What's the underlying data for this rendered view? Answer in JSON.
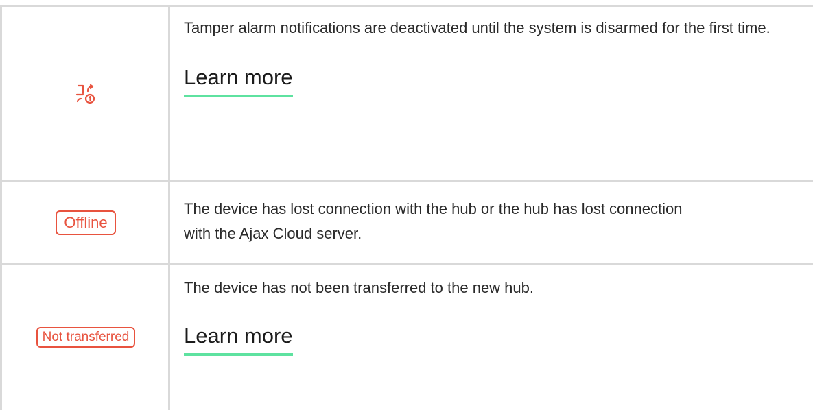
{
  "colors": {
    "status_red": "#e8533f",
    "link_underline": "#5ee2a0",
    "grid": "#d9d9d9"
  },
  "rows": [
    {
      "icon": "tamper-icon",
      "description": "Tamper alarm notifications are deactivated until the system is disarmed for the first time.",
      "link_label": "Learn more"
    },
    {
      "badge": "Offline",
      "description": "The device has lost connection with the hub or the hub has lost connection with the Ajax Cloud server."
    },
    {
      "badge": "Not transferred",
      "description": "The device has not been transferred to the new hub.",
      "link_label": "Learn more"
    }
  ]
}
